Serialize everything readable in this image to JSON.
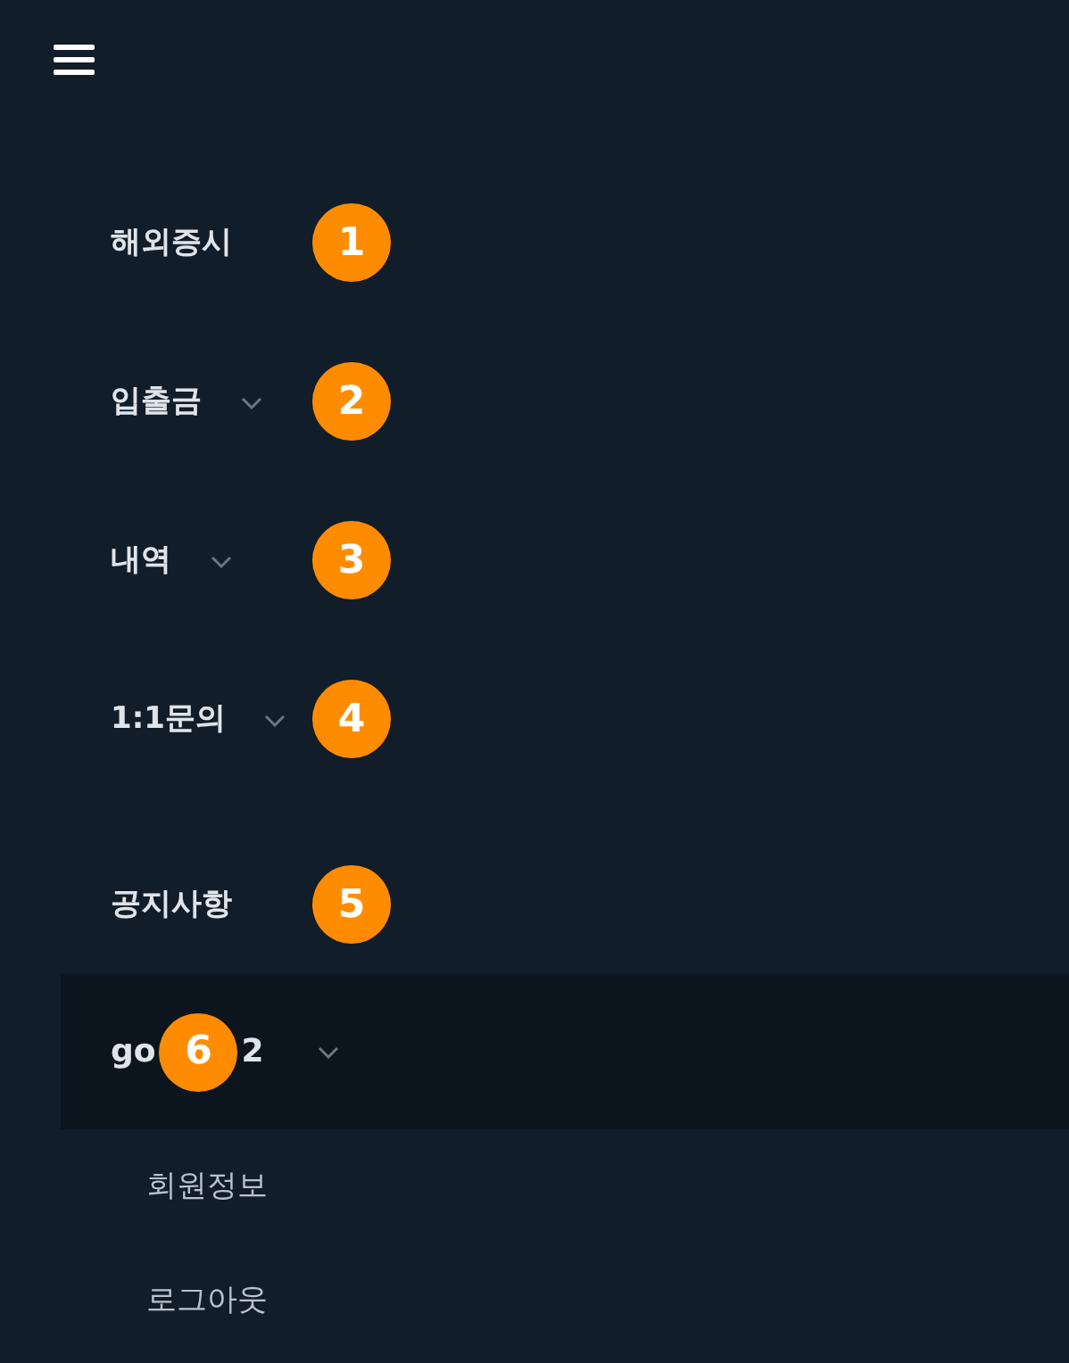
{
  "menu": [
    {
      "label": "해외증시",
      "expandable": false,
      "badge": "1"
    },
    {
      "label": "입출금",
      "expandable": true,
      "badge": "2"
    },
    {
      "label": "내역",
      "expandable": true,
      "badge": "3"
    },
    {
      "label": "1:1문의",
      "expandable": true,
      "badge": "4"
    },
    {
      "label": "공지사항",
      "expandable": false,
      "badge": "5"
    }
  ],
  "user": {
    "name_start": "go",
    "badge": "6",
    "name_end": "2",
    "expanded": true,
    "selected": true,
    "children": [
      {
        "label": "회원정보"
      },
      {
        "label": "로그아웃"
      }
    ]
  }
}
